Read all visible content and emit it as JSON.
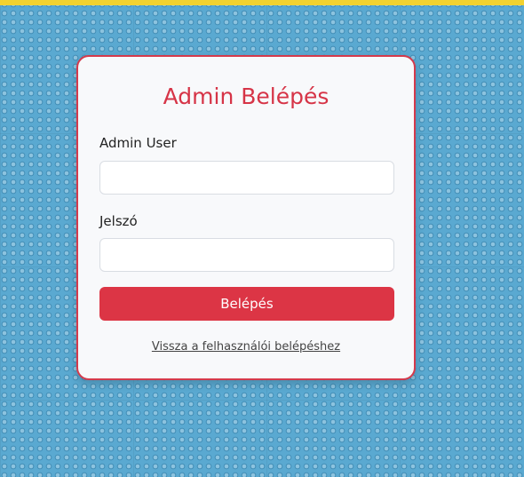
{
  "colors": {
    "accent": "#dc3545",
    "title": "#d63447",
    "card_border": "#d43a4c",
    "top_bar": "#f2d230",
    "background": "#5aa9d1"
  },
  "login": {
    "title": "Admin Belépés",
    "user_label": "Admin User",
    "user_value": "",
    "password_label": "Jelszó",
    "password_value": "",
    "submit_label": "Belépés",
    "back_link": "Vissza a felhasználói belépéshez"
  }
}
